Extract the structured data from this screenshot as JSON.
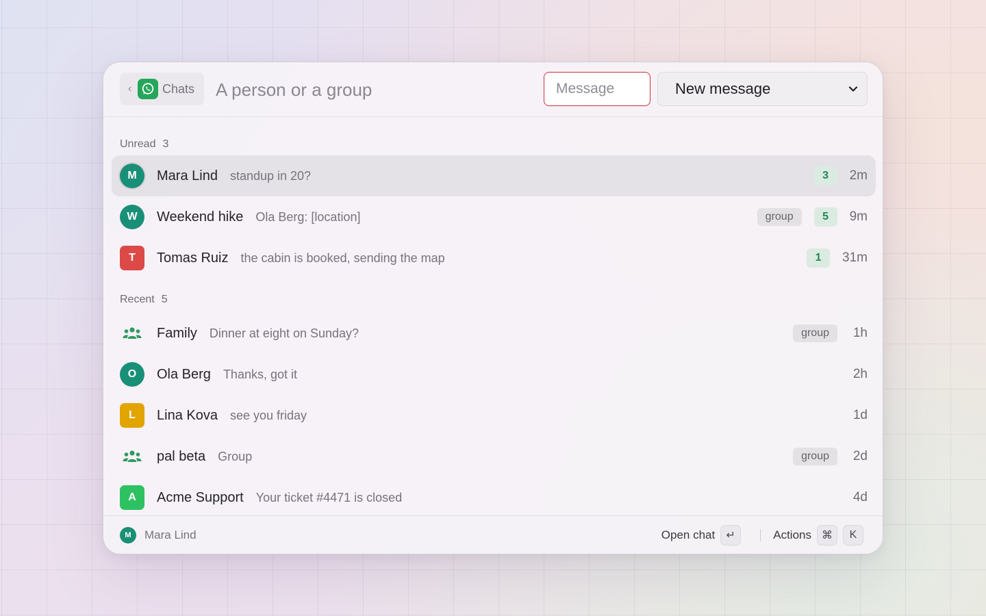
{
  "header": {
    "back_label": "Chats",
    "search_placeholder": "A person or a group",
    "message_placeholder": "Message",
    "dropdown_value": "New message"
  },
  "sections": {
    "unread": {
      "label": "Unread",
      "count": "3"
    },
    "recent": {
      "label": "Recent",
      "count": "5"
    }
  },
  "unread": [
    {
      "initial": "M",
      "name": "Mara Lind",
      "preview": "standup in 20?",
      "badge": "3",
      "time": "2m",
      "color": "#1a8f78"
    },
    {
      "initial": "W",
      "name": "Weekend hike",
      "preview": "Ola Berg: [location]",
      "tag": "group",
      "badge": "5",
      "time": "9m",
      "color": "#1a8f78"
    },
    {
      "initial": "T",
      "name": "Tomas Ruiz",
      "preview": "the cabin is booked, sending the map",
      "badge": "1",
      "time": "31m",
      "color": "#dc4a47"
    }
  ],
  "recent": [
    {
      "icon": "group-icon",
      "name": "Family",
      "preview": "Dinner at eight on Sunday?",
      "tag": "group",
      "time": "1h"
    },
    {
      "initial": "O",
      "name": "Ola Berg",
      "preview": "Thanks, got it",
      "time": "2h",
      "color": "#1a8f78"
    },
    {
      "initial": "L",
      "name": "Lina Kova",
      "preview": "see you friday",
      "time": "1d",
      "color": "#e2a400"
    },
    {
      "icon": "group-icon",
      "name": "pal beta",
      "preview": "Group",
      "tag": "group",
      "time": "2d"
    },
    {
      "initial": "A",
      "name": "Acme Support",
      "preview": "Your ticket #4471 is closed",
      "time": "4d",
      "color": "#2ec162"
    }
  ],
  "footer": {
    "user_initial": "M",
    "user_name": "Mara Lind",
    "open_label": "Open chat",
    "open_key": "↵",
    "actions_label": "Actions",
    "actions_keys": [
      "⌘",
      "K"
    ]
  }
}
